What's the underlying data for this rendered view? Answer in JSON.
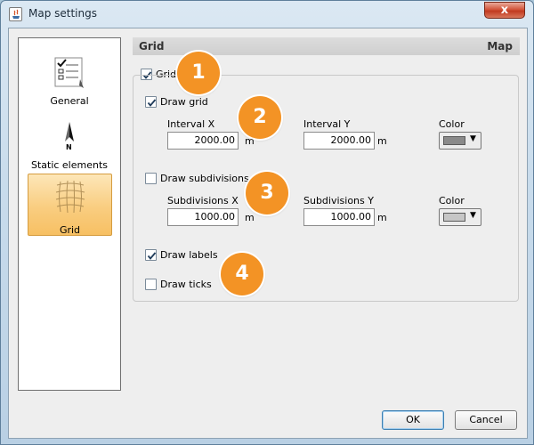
{
  "window": {
    "title": "Map settings",
    "close_label": "x"
  },
  "sidebar": {
    "items": [
      {
        "label": "General",
        "icon": "checklist-icon",
        "selected": false
      },
      {
        "label": "Static elements",
        "icon": "north-arrow-icon",
        "north_letter": "N",
        "selected": false
      },
      {
        "label": "Grid",
        "icon": "grid-icon",
        "selected": true
      }
    ]
  },
  "header": {
    "left": "Grid",
    "right": "Map"
  },
  "grid": {
    "enabled_label": "Grid",
    "enabled": true,
    "draw_grid_label": "Draw grid",
    "draw_grid": true,
    "interval_x_label": "Interval X",
    "interval_x": "2000.00",
    "interval_y_label": "Interval Y",
    "interval_y": "2000.00",
    "unit": "m",
    "color_label": "Color",
    "grid_color": "#8a8a8a",
    "draw_subdivisions_label": "Draw subdivisions",
    "draw_subdivisions": false,
    "subdivisions_x_label": "Subdivisions X",
    "subdivisions_x": "1000.00",
    "subdivisions_y_label": "Subdivisions Y",
    "subdivisions_y": "1000.00",
    "subdivision_color_label": "Color",
    "subdivision_color": "#c6c6c6",
    "draw_labels_label": "Draw labels",
    "draw_labels": true,
    "draw_ticks_label": "Draw ticks",
    "draw_ticks": false
  },
  "badges": [
    "1",
    "2",
    "3",
    "4"
  ],
  "badge_color": "#f39325",
  "footer": {
    "ok_label": "OK",
    "cancel_label": "Cancel"
  }
}
